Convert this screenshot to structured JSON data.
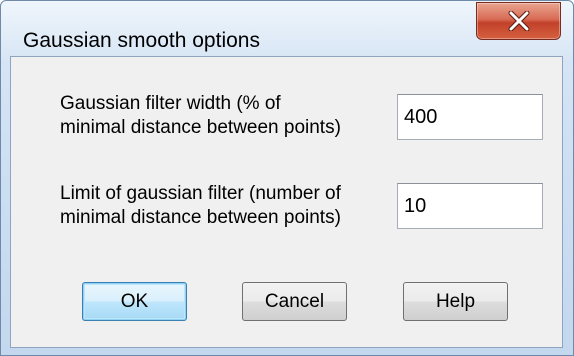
{
  "window": {
    "title": "Gaussian smooth options"
  },
  "titlebar": {
    "close_icon": "close-icon"
  },
  "fields": {
    "width": {
      "label_line1": "Gaussian filter width  (% of",
      "label_line2": "minimal distance between points)",
      "value": "400"
    },
    "limit": {
      "label_line1": "Limit of gaussian filter (number of",
      "label_line2": "minimal distance between points)",
      "value": "10"
    }
  },
  "buttons": {
    "ok": "OK",
    "cancel": "Cancel",
    "help": "Help"
  },
  "colors": {
    "close_button": "#c7432c",
    "window_frame": "#cfe0f3",
    "client_bg": "#f0f0f0",
    "default_button_border": "#3c7fb1"
  }
}
